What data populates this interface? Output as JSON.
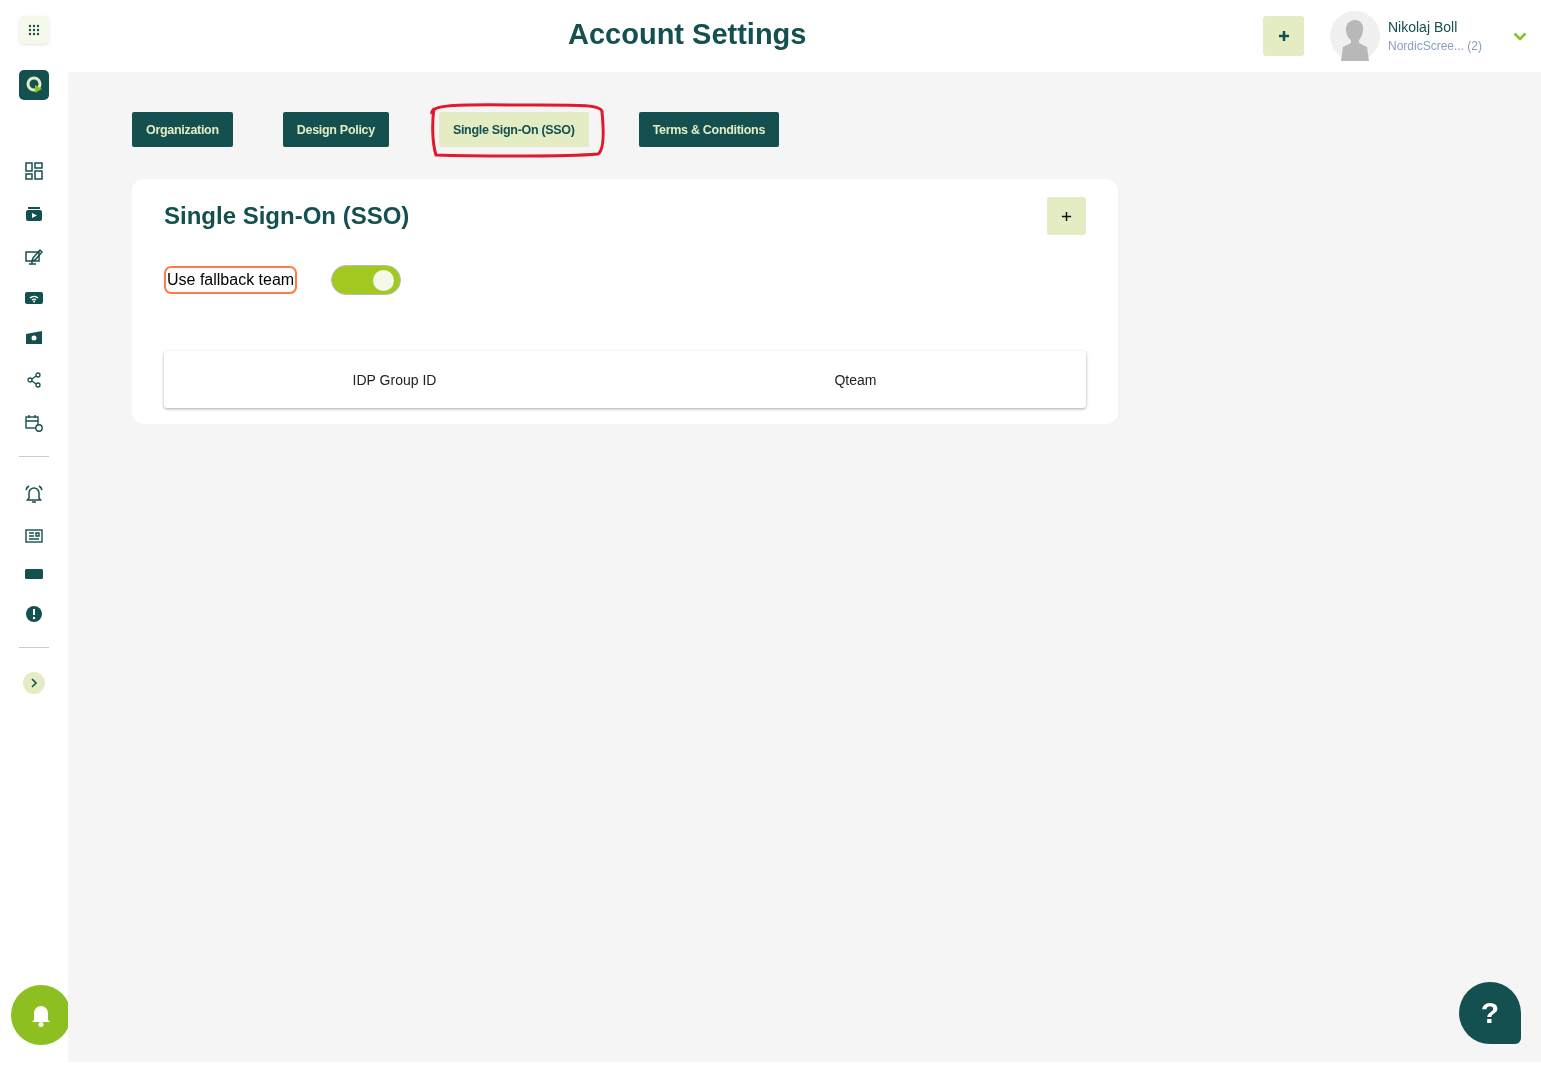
{
  "header": {
    "title": "Account Settings",
    "user": {
      "name": "Nikolaj Boll",
      "organization": "NordicScree... (2)"
    }
  },
  "tabs": [
    {
      "label": "Organization",
      "selected": false
    },
    {
      "label": "Design Policy",
      "selected": false
    },
    {
      "label": "Single Sign-On (SSO)",
      "selected": true
    },
    {
      "label": "Terms & Conditions",
      "selected": false
    }
  ],
  "card": {
    "title": "Single Sign-On (SSO)",
    "fallback": {
      "label": "Use fallback team",
      "on": true
    },
    "table": {
      "columns": [
        "IDP Group ID",
        "Qteam"
      ]
    }
  },
  "help": {
    "label": "?"
  }
}
